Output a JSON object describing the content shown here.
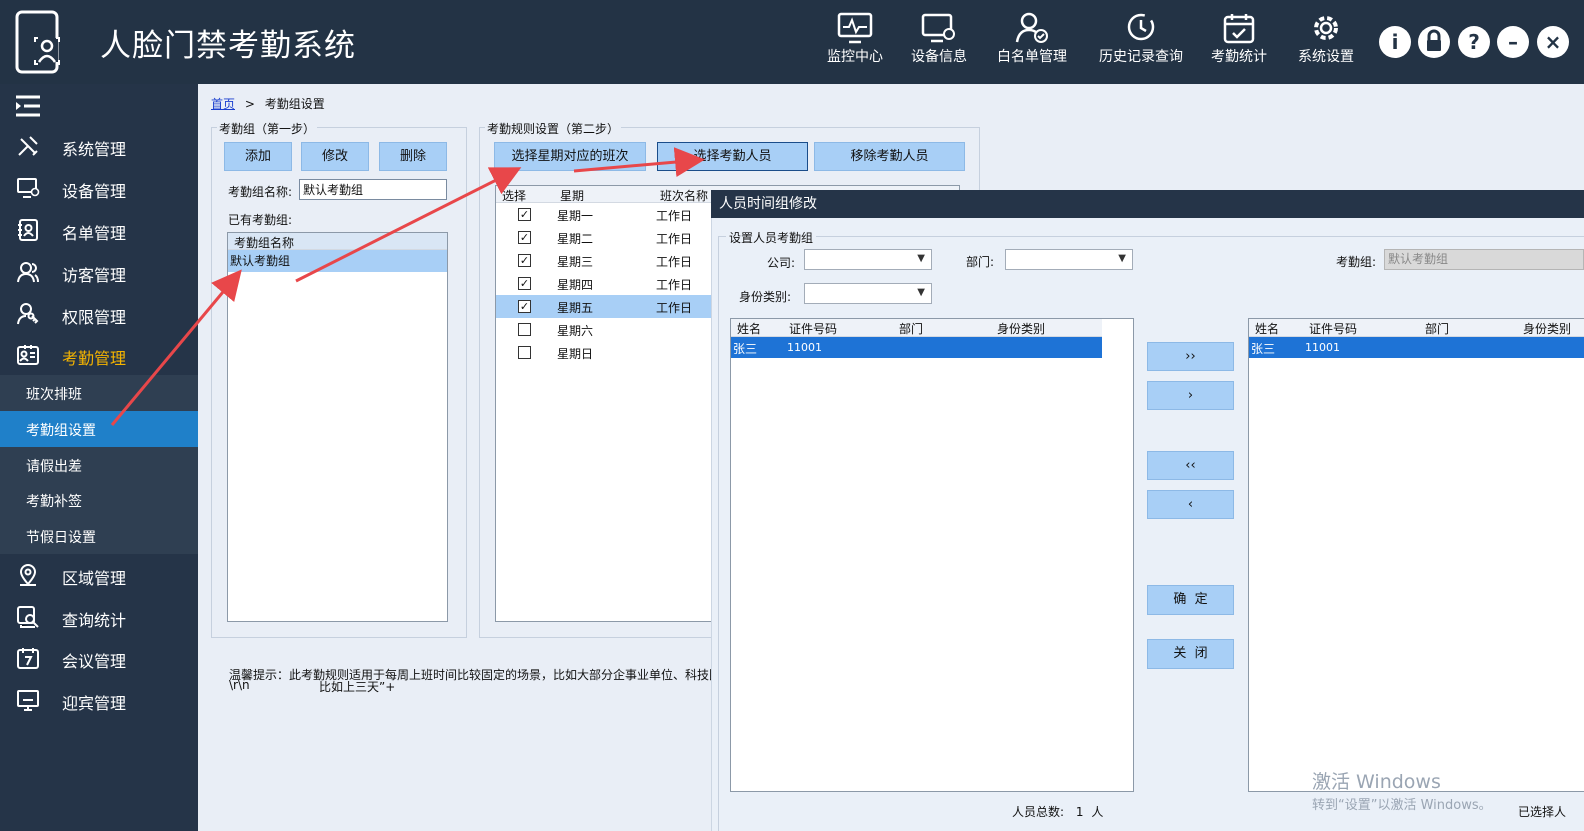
{
  "app": {
    "title": "人脸门禁考勤系统"
  },
  "topnav": [
    {
      "label": "监控中心",
      "icon": "monitor-chart-icon"
    },
    {
      "label": "设备信息",
      "icon": "device-gear-icon"
    },
    {
      "label": "白名单管理",
      "icon": "user-check-icon"
    },
    {
      "label": "历史记录查询",
      "icon": "clock-history-icon"
    },
    {
      "label": "考勤统计",
      "icon": "calendar-check-icon"
    },
    {
      "label": "系统设置",
      "icon": "gear-icon"
    }
  ],
  "window_controls": {
    "info": "i",
    "lock": "lock",
    "help": "?",
    "minimize": "–",
    "close": "×"
  },
  "sidebar": {
    "items": [
      {
        "label": "系统管理",
        "icon": "tools-icon"
      },
      {
        "label": "设备管理",
        "icon": "device-icon"
      },
      {
        "label": "名单管理",
        "icon": "contacts-icon"
      },
      {
        "label": "访客管理",
        "icon": "visitors-icon"
      },
      {
        "label": "权限管理",
        "icon": "key-user-icon"
      },
      {
        "label": "考勤管理",
        "icon": "id-card-icon",
        "active": true
      }
    ],
    "subitems": [
      {
        "label": "班次排班"
      },
      {
        "label": "考勤组设置",
        "active": true
      },
      {
        "label": "请假出差"
      },
      {
        "label": "考勤补签"
      },
      {
        "label": "节假日设置"
      }
    ],
    "items_after": [
      {
        "label": "区域管理",
        "icon": "location-icon"
      },
      {
        "label": "查询统计",
        "icon": "search-report-icon"
      },
      {
        "label": "会议管理",
        "icon": "calendar-7-icon"
      },
      {
        "label": "迎宾管理",
        "icon": "screen-icon"
      }
    ]
  },
  "breadcrumb": {
    "home": "首页",
    "sep": ">",
    "current": "考勤组设置"
  },
  "group_step1": {
    "title": "考勤组（第一步）",
    "add": "添加",
    "edit": "修改",
    "delete": "删除",
    "name_label": "考勤组名称:",
    "name_value": "默认考勤组",
    "existing_label": "已有考勤组:",
    "list_header": "考勤组名称",
    "list_items": [
      "默认考勤组"
    ]
  },
  "group_step2": {
    "title": "考勤规则设置（第二步）",
    "btn_shift": "选择星期对应的班次",
    "btn_select_staff": "选择考勤人员",
    "btn_remove_staff": "移除考勤人员",
    "headers": [
      "选择",
      "星期",
      "班次名称"
    ],
    "rows": [
      {
        "checked": true,
        "day": "星期一",
        "shift": "工作日"
      },
      {
        "checked": true,
        "day": "星期二",
        "shift": "工作日"
      },
      {
        "checked": true,
        "day": "星期三",
        "shift": "工作日"
      },
      {
        "checked": true,
        "day": "星期四",
        "shift": "工作日"
      },
      {
        "checked": true,
        "day": "星期五",
        "shift": "工作日"
      },
      {
        "checked": false,
        "day": "星期六",
        "shift": ""
      },
      {
        "checked": false,
        "day": "星期日",
        "shift": ""
      }
    ],
    "check_mark": "✓"
  },
  "tip": {
    "line1": "温馨提示：此考勤规则适用于每周上班时间比较固定的场景，比如大部分企事业单位、科技图",
    "line2_a": "\\r\\n",
    "line2_b": "比如上三天”+"
  },
  "dialog": {
    "title": "人员时间组修改",
    "section": "设置人员考勤组",
    "company_label": "公司:",
    "dept_label": "部门:",
    "idtype_label": "身份类别:",
    "group_label": "考勤组:",
    "group_value": "默认考勤组",
    "left_headers": [
      "姓名",
      "证件号码",
      "部门",
      "身份类别"
    ],
    "left_rows": [
      {
        "name": "张三",
        "id": "11001",
        "dept": "",
        "type": ""
      }
    ],
    "right_headers": [
      "姓名",
      "证件号码",
      "部门",
      "身份类别"
    ],
    "right_rows": [
      {
        "name": "张三",
        "id": "11001"
      }
    ],
    "btn_all_right": "››",
    "btn_right": "›",
    "btn_all_left": "‹‹",
    "btn_left": "‹",
    "btn_ok": "确  定",
    "btn_close": "关  闭",
    "total_label": "人员总数:",
    "total_value": "1",
    "total_unit": "人",
    "selected_label": "已选择人"
  },
  "watermark": {
    "line1": "激活 Windows",
    "line2": "转到“设置”以激活 Windows。"
  },
  "colors": {
    "topbar": "#233345",
    "sidebar": "#253448",
    "active_sub": "#1f80c9",
    "active_text": "#f5b400",
    "button": "#a8cff6",
    "selection": "#1e73d6",
    "arrow": "#e8474a"
  }
}
